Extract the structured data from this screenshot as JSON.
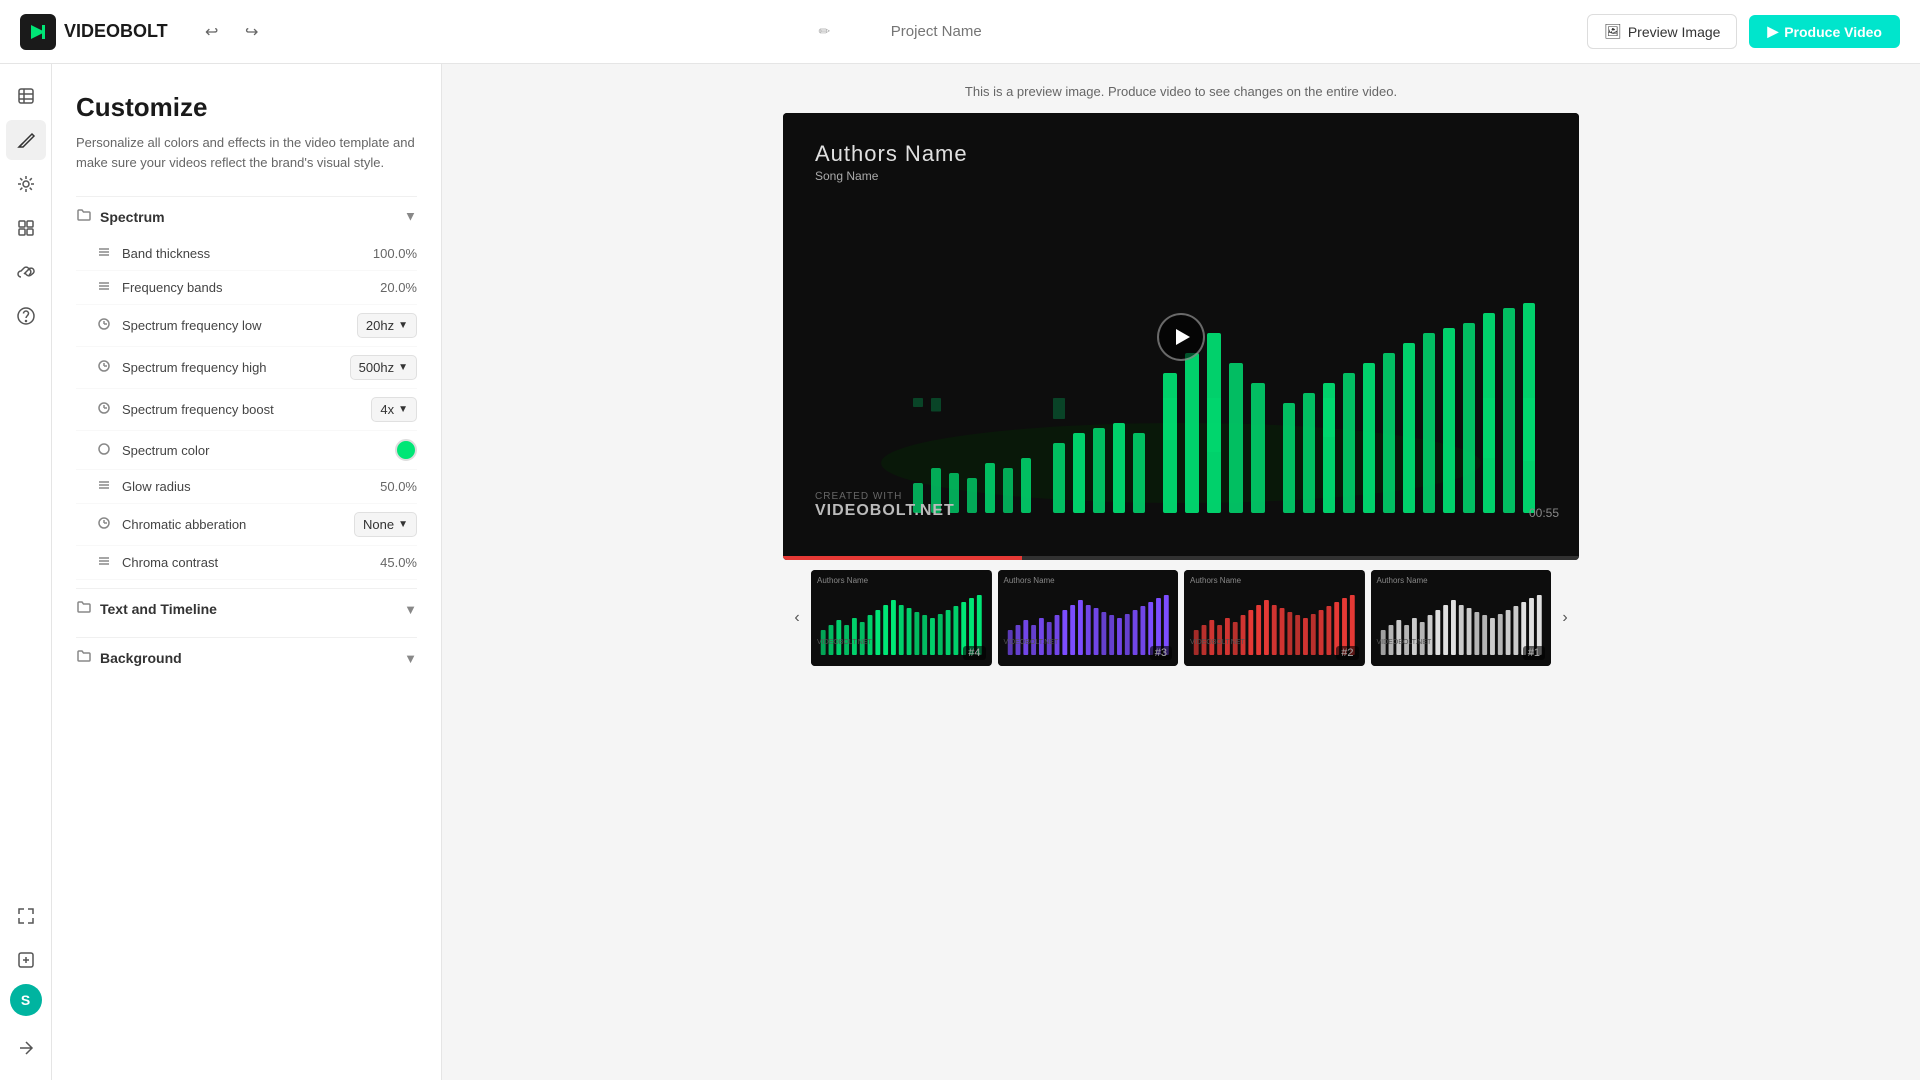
{
  "topbar": {
    "logo_text": "VIDEOBOLT",
    "logo_icon": "VB",
    "undo_label": "Undo",
    "redo_label": "Redo",
    "project_name_placeholder": "Project Name",
    "preview_image_label": "Preview Image",
    "produce_video_label": "Produce Video"
  },
  "sidebar_icons": {
    "icons": [
      {
        "name": "layers-icon",
        "symbol": "⊞",
        "active": false
      },
      {
        "name": "brush-icon",
        "symbol": "✏",
        "active": true
      },
      {
        "name": "sliders-icon",
        "symbol": "⚙",
        "active": false
      },
      {
        "name": "grid-icon",
        "symbol": "▦",
        "active": false
      },
      {
        "name": "link-icon",
        "symbol": "↗",
        "active": false
      },
      {
        "name": "help-icon",
        "symbol": "?",
        "active": false
      }
    ],
    "bottom_icons": [
      {
        "name": "fullscreen-icon",
        "symbol": "⤢"
      },
      {
        "name": "edit-icon",
        "symbol": "✎"
      },
      {
        "name": "share-icon",
        "symbol": "↩"
      }
    ],
    "avatar_label": "S"
  },
  "customize": {
    "title": "Customize",
    "description": "Personalize all colors and effects in the video template and make sure your videos reflect the brand's visual style."
  },
  "spectrum_section": {
    "label": "Spectrum",
    "is_open": true,
    "properties": [
      {
        "icon": "sliders",
        "label": "Band thickness",
        "type": "value",
        "value": "100.0%"
      },
      {
        "icon": "sliders",
        "label": "Frequency bands",
        "type": "value",
        "value": "20.0%"
      },
      {
        "icon": "settings",
        "label": "Spectrum frequency low",
        "type": "dropdown",
        "value": "20hz"
      },
      {
        "icon": "settings",
        "label": "Spectrum frequency high",
        "type": "dropdown",
        "value": "500hz"
      },
      {
        "icon": "settings",
        "label": "Spectrum frequency boost",
        "type": "dropdown",
        "value": "4x"
      },
      {
        "icon": "settings",
        "label": "Spectrum color",
        "type": "color",
        "value": "#00e676"
      },
      {
        "icon": "sliders",
        "label": "Glow radius",
        "type": "value",
        "value": "50.0%"
      },
      {
        "icon": "settings",
        "label": "Chromatic abberation",
        "type": "dropdown",
        "value": "None"
      },
      {
        "icon": "sliders",
        "label": "Chroma contrast",
        "type": "value",
        "value": "45.0%"
      }
    ]
  },
  "text_timeline_section": {
    "label": "Text and Timeline",
    "is_open": false
  },
  "background_section": {
    "label": "Background",
    "is_open": false
  },
  "preview": {
    "notice": "This is a preview image. Produce video to see changes on the entire video.",
    "author": "Authors Name",
    "song": "Song Name",
    "watermark_line1": "CREATED WITH",
    "watermark_line2": "VIDEOBOLT.NET",
    "timecode": "00:55",
    "progress_pct": 30
  },
  "thumbnails": [
    {
      "badge": "#4",
      "color": "green",
      "author": "Authors Name"
    },
    {
      "badge": "#3",
      "color": "purple",
      "author": "Authors Name"
    },
    {
      "badge": "#2",
      "color": "red",
      "author": "Authors Name"
    },
    {
      "badge": "#1",
      "color": "white",
      "author": "Authors Name"
    }
  ]
}
